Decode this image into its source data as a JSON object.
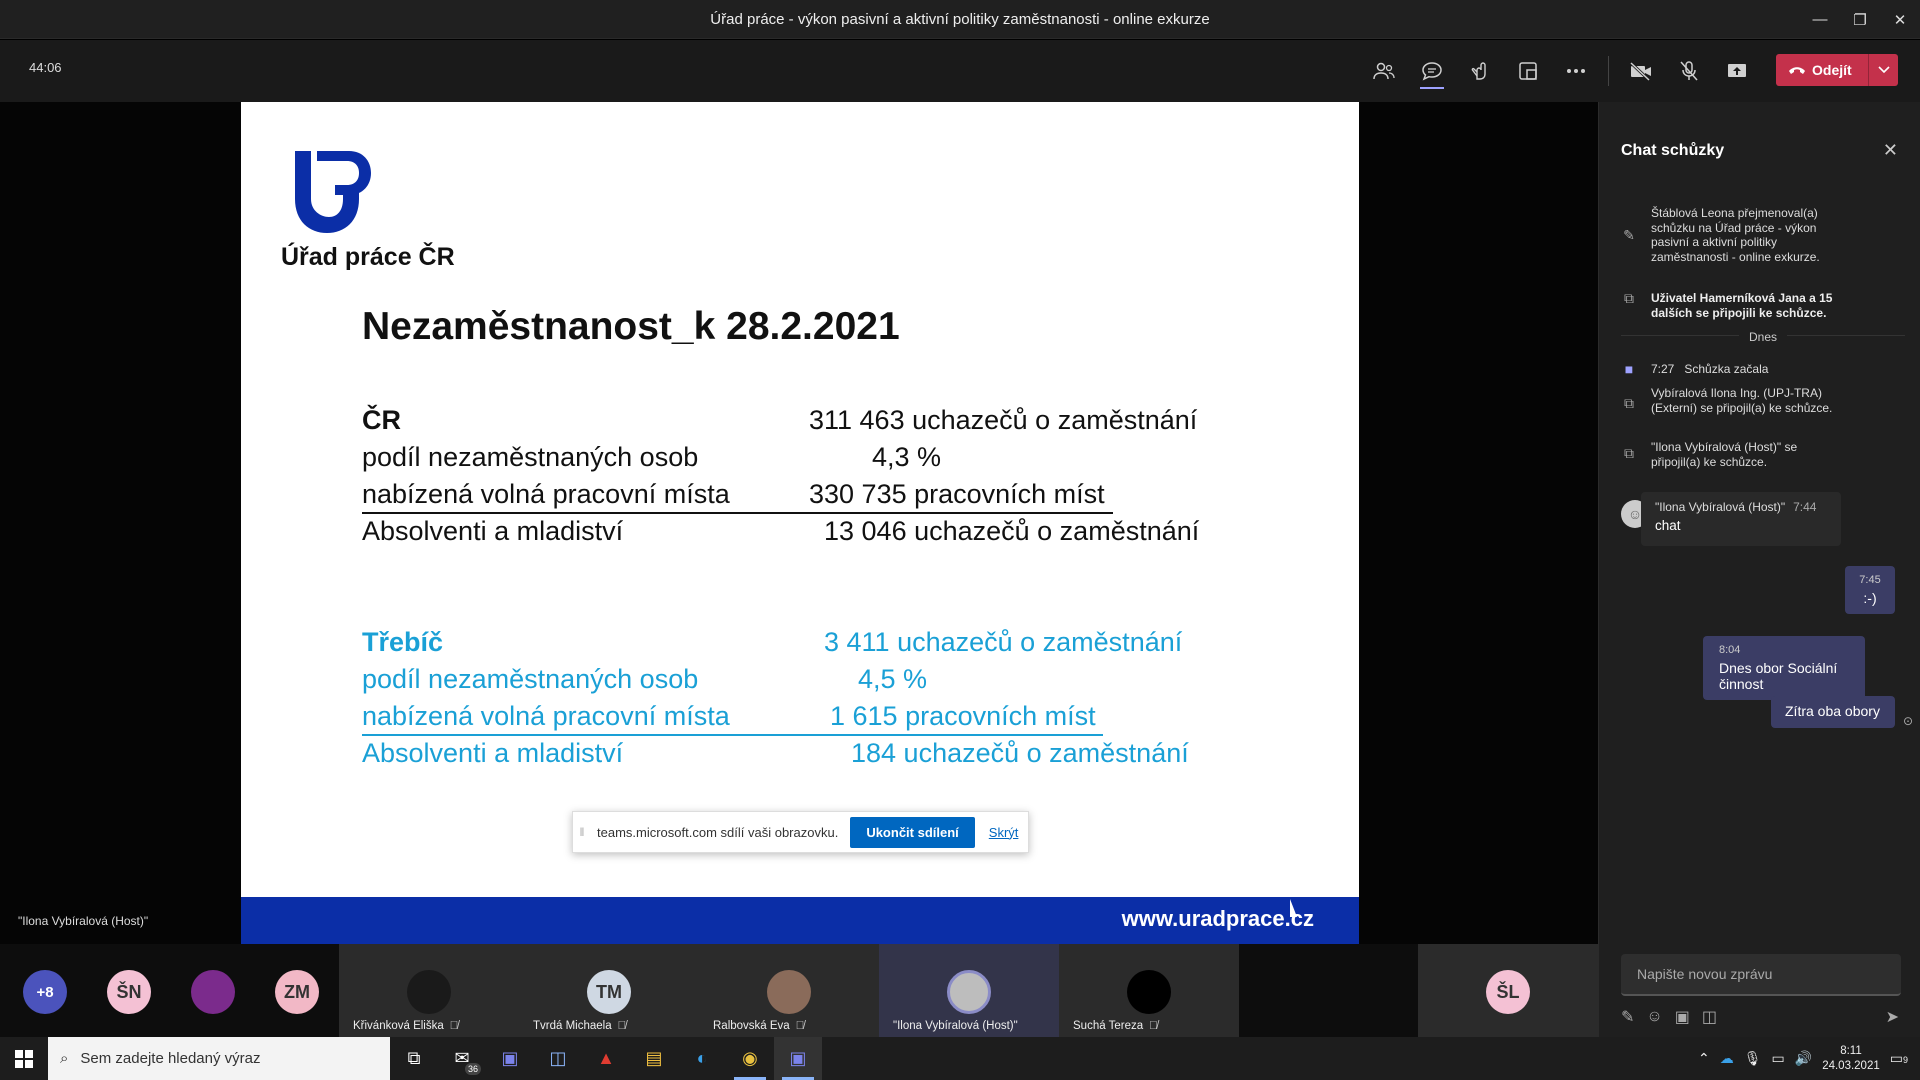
{
  "window": {
    "title": "Úřad práce - výkon pasivní a aktivní politiky zaměstnanosti - online exkurze",
    "controls": [
      "—",
      "❐",
      "✕"
    ]
  },
  "toolbar": {
    "timer": "44:06",
    "leave_label": "Odejít"
  },
  "slide": {
    "org": "Úřad práce ČR",
    "title": "Nezaměstnanost_k 28.2.2021",
    "cr": [
      {
        "label": "ČR",
        "value": "311 463 uchazečů o zaměstnání"
      },
      {
        "label": "podíl nezaměstnaných osob",
        "value": "4,3 %"
      },
      {
        "label": "nabízená volná pracovní místa",
        "value": "330 735 pracovních míst"
      },
      {
        "label": "Absolventi a mladiství",
        "value": "13 046 uchazečů o zaměstnání"
      }
    ],
    "trebic": [
      {
        "label": "Třebíč",
        "value": "3  411 uchazečů o zaměstnání"
      },
      {
        "label": "podíl nezaměstnaných osob",
        "value": "4,5 %"
      },
      {
        "label": "nabízená volná pracovní místa",
        "value": "1 615 pracovních míst"
      },
      {
        "label": "Absolventi a mladiství",
        "value": "184 uchazečů o zaměstnání"
      }
    ],
    "footer_url": "www.uradprace.cz",
    "colors": {
      "blue_text": "#1aa0d6",
      "footer": "#0b2ea7",
      "logo": "#0b2ea7"
    }
  },
  "share_bar": {
    "text": "teams.microsoft.com sdílí vaši obrazovku.",
    "stop_label": "Ukončit sdílení",
    "hide_label": "Skrýt"
  },
  "presenter_label": "\"Ilona Vybíralová (Host)\"",
  "chat": {
    "title": "Chat schůzky",
    "events": [
      {
        "icon": "pencil-icon",
        "text": "Štáblová Leona přejmenoval(a) schůzku na Úřad práce - výkon pasivní a aktivní politiky zaměstnanosti - online exkurze."
      },
      {
        "icon": "join-icon",
        "text": "Uživatel Hamerníková Jana a 15 dalších se připojili ke schůzce."
      }
    ],
    "day_label": "Dnes",
    "meeting_started": {
      "time": "7:27",
      "text": "Schůzka začala"
    },
    "events2": [
      {
        "icon": "join-icon",
        "text": "Vybíralová Ilona Ing. (UPJ-TRA) (Externí) se připojil(a) ke schůzce."
      },
      {
        "icon": "join-icon",
        "text": "\"Ilona Vybíralová (Host)\" se připojil(a) ke schůzce."
      }
    ],
    "incoming": {
      "sender": "\"Ilona Vybíralová (Host)\"",
      "time": "7:44",
      "text": "chat"
    },
    "outgoing": [
      {
        "time": "7:45",
        "text": ":-)"
      },
      {
        "time": "8:04",
        "text": "Dnes obor Sociální činnost"
      },
      {
        "time": "",
        "text": "Zítra oba obory"
      }
    ],
    "input_placeholder": "Napište novou zprávu"
  },
  "participants": {
    "overflow": "+8",
    "circles": [
      {
        "initials": "ŠN",
        "color": "#f4c1d4"
      },
      {
        "initials": "",
        "color": "#7b2b8c"
      },
      {
        "initials": "ZM",
        "color": "#f2b8c6"
      }
    ],
    "tiles": [
      {
        "name": "Křivánková Eliška",
        "initials": "",
        "color": "#1a1a1a"
      },
      {
        "name": "Tvrdá Michaela",
        "initials": "TM",
        "color": "#cfd8e3"
      },
      {
        "name": "Ralbovská Eva",
        "initials": "",
        "color": "#8a6b5a"
      },
      {
        "name": "\"Ilona Vybíralová (Host)\"",
        "initials": "",
        "color": "#bdbdbd"
      },
      {
        "name": "Suchá Tereza",
        "initials": "",
        "color": "#000000"
      }
    ],
    "sl": {
      "initials": "ŠL",
      "color": "#f4c1d4"
    }
  },
  "taskbar": {
    "search_placeholder": "Sem zadejte hledaný výraz",
    "mail_badge": "36",
    "time": "8:11",
    "date": "24.03.2021",
    "notif_badge": "9"
  }
}
